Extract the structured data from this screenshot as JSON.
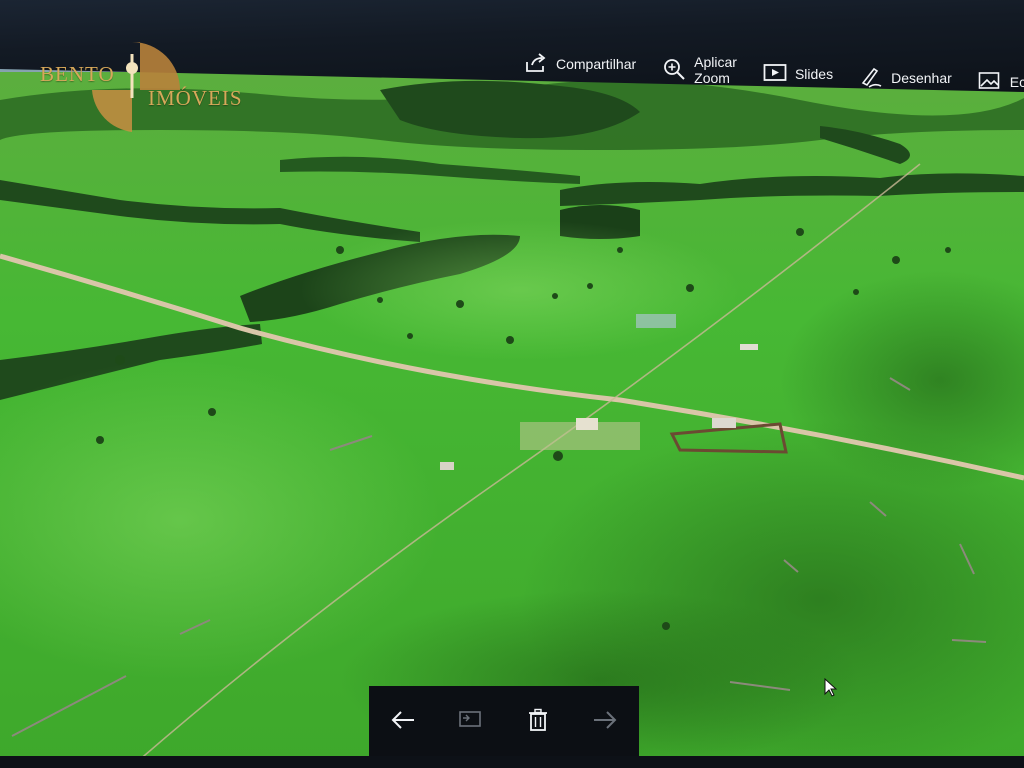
{
  "toolbar": {
    "items": [
      {
        "label": "Compartilhar",
        "icon": "share-icon"
      },
      {
        "label": "Aplicar Zoom",
        "icon": "zoom-in-icon"
      },
      {
        "label": "Slides",
        "icon": "slideshow-icon"
      },
      {
        "label": "Desenhar",
        "icon": "draw-icon"
      },
      {
        "label": "Ec",
        "icon": "edit-image-icon"
      }
    ]
  },
  "watermark": {
    "text_1": "BENTO",
    "text_2": "IMÓVEIS",
    "colors": {
      "gold": "#d7a85a",
      "bronze": "#b8823b"
    }
  },
  "nav_bar": {
    "buttons": [
      {
        "icon": "back-arrow-icon"
      },
      {
        "icon": "slideshow-mini-icon"
      },
      {
        "icon": "trash-icon"
      },
      {
        "icon": "forward-arrow-icon"
      }
    ]
  },
  "colors": {
    "pasture": "#43b832",
    "pasture_dark": "#2e8a22",
    "forest": "#1f4a1c",
    "road": "#d9c6a8",
    "toolbar_bg": "#131a24"
  }
}
